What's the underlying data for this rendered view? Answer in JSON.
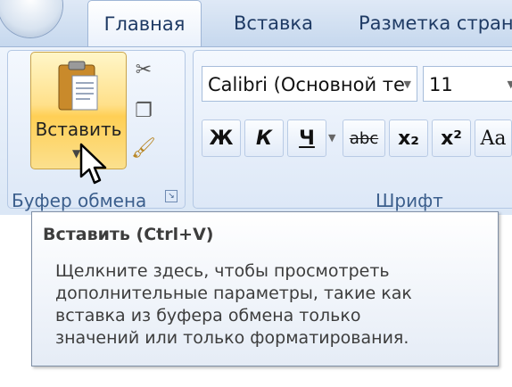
{
  "tabs": [
    {
      "label": "Главная",
      "active": true
    },
    {
      "label": "Вставка",
      "active": false
    },
    {
      "label": "Разметка страни",
      "active": false
    }
  ],
  "clipboard_group": {
    "label": "Буфер обмена",
    "paste_label": "Вставить",
    "icons": [
      "scissors-icon",
      "copy-icon",
      "format-painter-icon",
      "dialog-launcher-icon"
    ]
  },
  "font_group": {
    "label": "Шрифт",
    "font_name": "Calibri (Основной те",
    "font_size": "11",
    "format_buttons": [
      {
        "name": "bold",
        "label": "Ж"
      },
      {
        "name": "italic",
        "label": "К"
      },
      {
        "name": "underline",
        "label": "Ч"
      },
      {
        "name": "strikethrough",
        "label": "abc"
      },
      {
        "name": "subscript",
        "label": "x₂"
      },
      {
        "name": "superscript",
        "label": "x²"
      },
      {
        "name": "change-case",
        "label": "Aa"
      }
    ]
  },
  "tooltip": {
    "title": "Вставить (Ctrl+V)",
    "body_lines": [
      "Щелкните здесь, чтобы просмотреть",
      "дополнительные параметры, такие как",
      "вставка из буфера обмена только",
      "значений или только форматирования."
    ]
  },
  "colors": {
    "accent": "#ffcf55",
    "ribbon": "#dbe7f6",
    "text_blue": "#1e3a64"
  }
}
